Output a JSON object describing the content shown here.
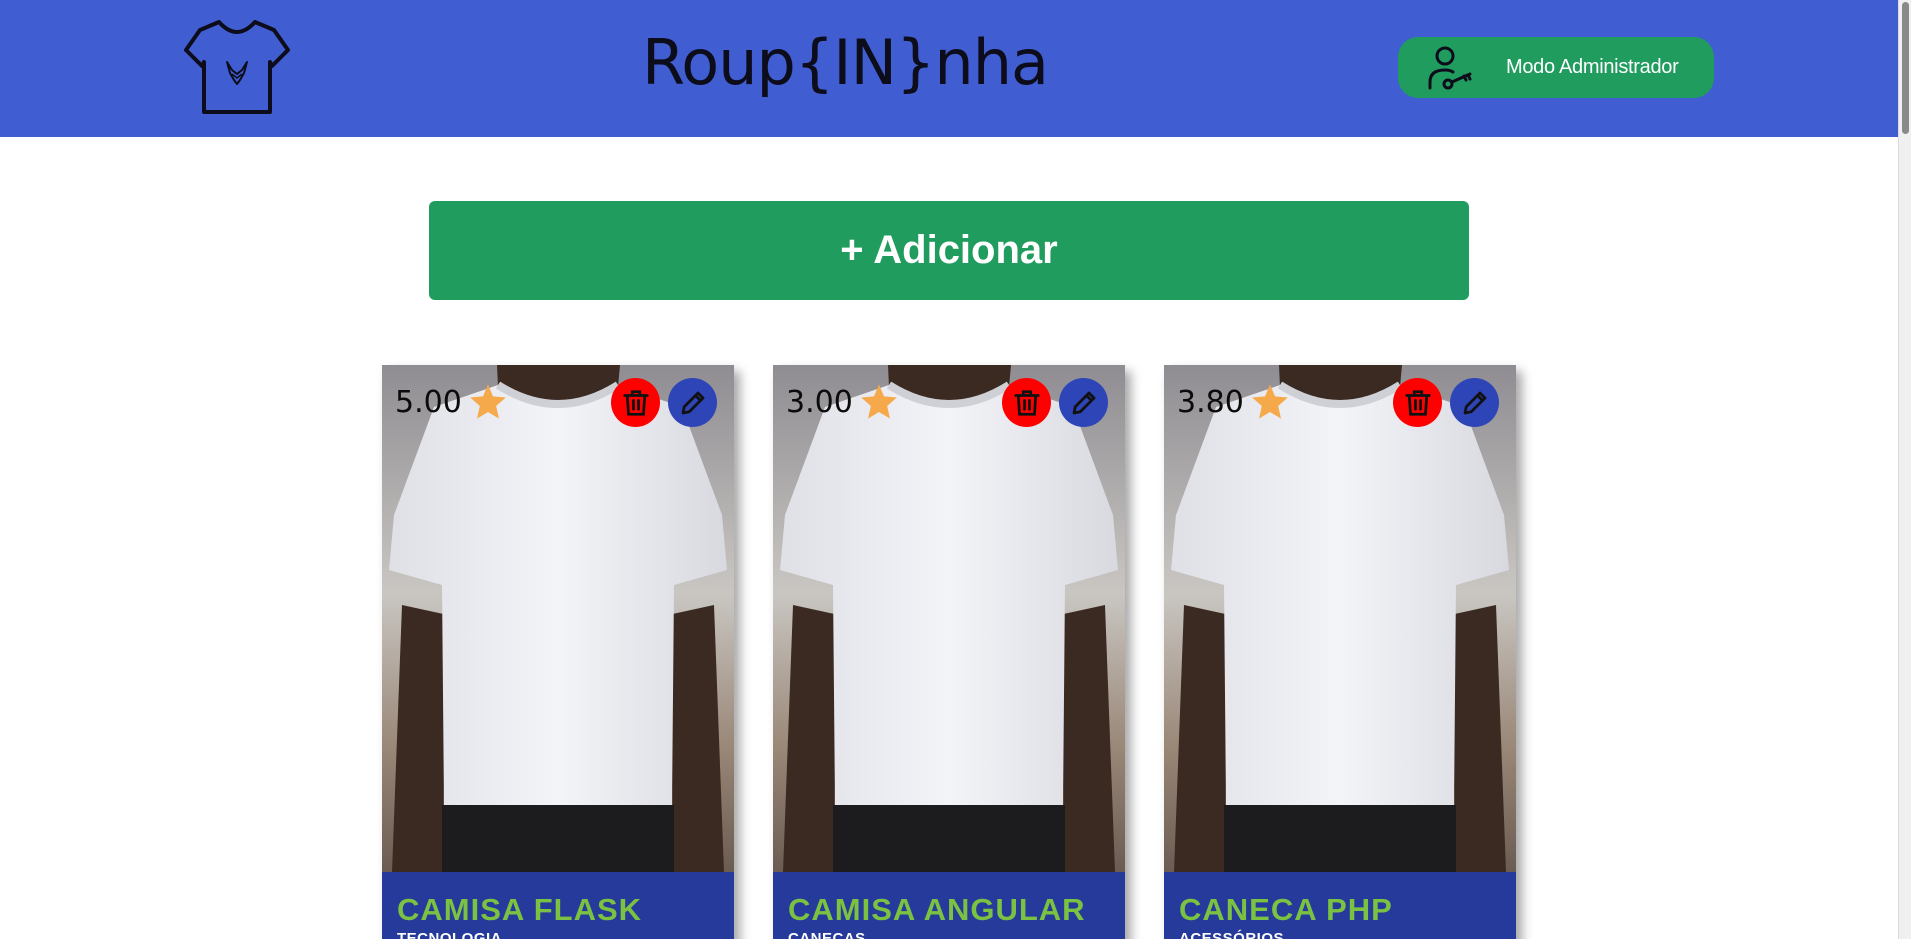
{
  "header": {
    "logo_icon": "tshirt-fox-logo-icon",
    "title": "Roup{IN}nha",
    "admin_button": {
      "label": "Modo Administrador",
      "icon": "user-key-icon"
    },
    "background_color": "#405ed2"
  },
  "actions": {
    "add_label": "+ Adicionar",
    "add_color": "#1f9c5e"
  },
  "products": [
    {
      "rating": "5.00",
      "name": "CAMISA FLASK",
      "category": "TECNOLOGIA"
    },
    {
      "rating": "3.00",
      "name": "CAMISA ANGULAR",
      "category": "CANECAS"
    },
    {
      "rating": "3.80",
      "name": "CANECA PHP",
      "category": "ACESSÓRIOS"
    }
  ],
  "icons": {
    "rating": "star-icon",
    "delete": "trash-icon",
    "edit": "pencil-icon"
  },
  "colors": {
    "product_name": "#7bc142",
    "card_footer": "#253a9a",
    "delete_button": "#ff0000",
    "edit_button": "#2e45b8",
    "star": "#f6a94a"
  }
}
